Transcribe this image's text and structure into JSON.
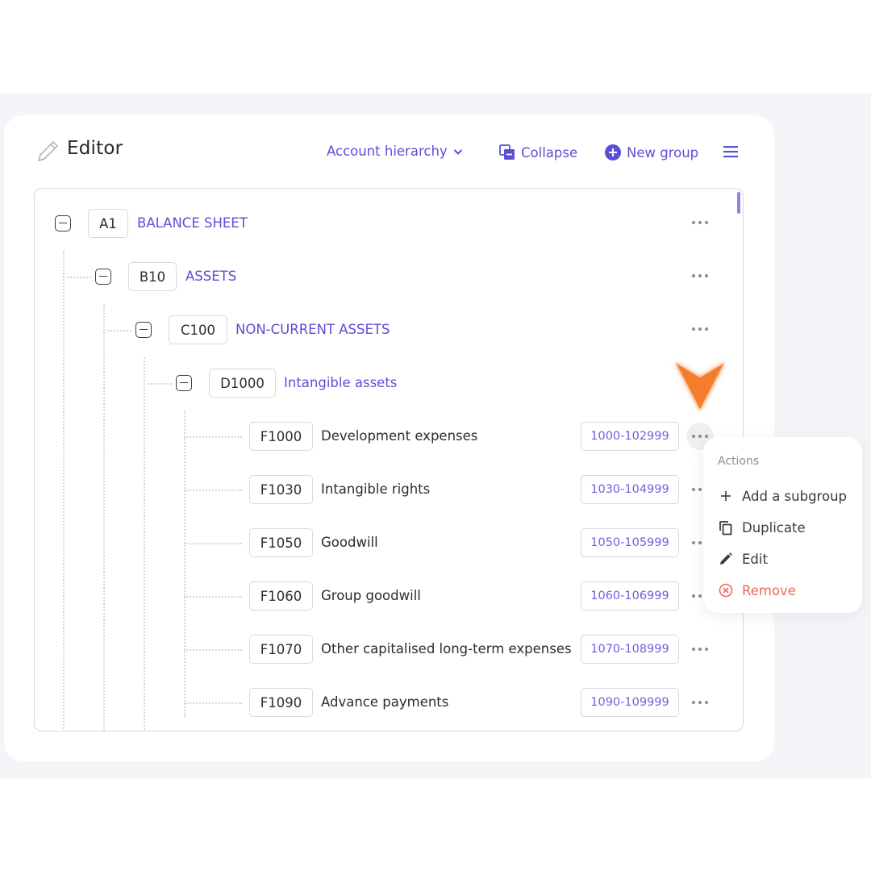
{
  "header": {
    "title": "Editor",
    "view_select": "Account hierarchy",
    "collapse_label": "Collapse",
    "new_group_label": "New group"
  },
  "tree": {
    "groups": [
      {
        "code": "A1",
        "label": "BALANCE SHEET"
      },
      {
        "code": "B10",
        "label": "ASSETS"
      },
      {
        "code": "C100",
        "label": "NON-CURRENT ASSETS"
      },
      {
        "code": "D1000",
        "label": "Intangible assets"
      }
    ],
    "accounts": [
      {
        "code": "F1000",
        "label": "Development expenses",
        "range": "1000-102999"
      },
      {
        "code": "F1030",
        "label": "Intangible rights",
        "range": "1030-104999"
      },
      {
        "code": "F1050",
        "label": "Goodwill",
        "range": "1050-105999"
      },
      {
        "code": "F1060",
        "label": "Group goodwill",
        "range": "1060-106999"
      },
      {
        "code": "F1070",
        "label": "Other capitalised long-term expenses",
        "range": "1070-108999"
      },
      {
        "code": "F1090",
        "label": "Advance payments",
        "range": "1090-109999"
      }
    ]
  },
  "actions_menu": {
    "title": "Actions",
    "items": [
      {
        "label": "Add a subgroup",
        "icon": "plus-icon"
      },
      {
        "label": "Duplicate",
        "icon": "duplicate-icon"
      },
      {
        "label": "Edit",
        "icon": "pencil-icon"
      },
      {
        "label": "Remove",
        "icon": "remove-circle-icon"
      }
    ]
  },
  "colors": {
    "accent": "#5b4fd6",
    "pointer": "#f47c2c",
    "danger": "#e96a5e"
  }
}
